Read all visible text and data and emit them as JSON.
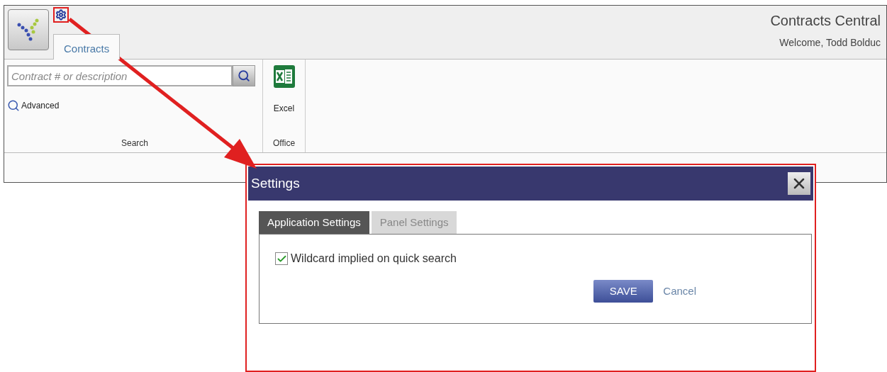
{
  "header": {
    "title": "Contracts Central",
    "welcome": "Welcome, Todd Bolduc"
  },
  "tabs": [
    {
      "label": "Contracts",
      "selected": true
    }
  ],
  "ribbon": {
    "search": {
      "placeholder": "Contract # or description",
      "advanced": "Advanced",
      "group_label": "Search"
    },
    "office": {
      "excel": "Excel",
      "group_label": "Office"
    }
  },
  "dialog": {
    "title": "Settings",
    "tabs": [
      {
        "label": "Application Settings",
        "selected": true
      },
      {
        "label": "Panel Settings",
        "selected": false
      }
    ],
    "options": [
      {
        "label": "Wildcard implied on quick search",
        "checked": true
      }
    ],
    "save": "SAVE",
    "cancel": "Cancel"
  }
}
